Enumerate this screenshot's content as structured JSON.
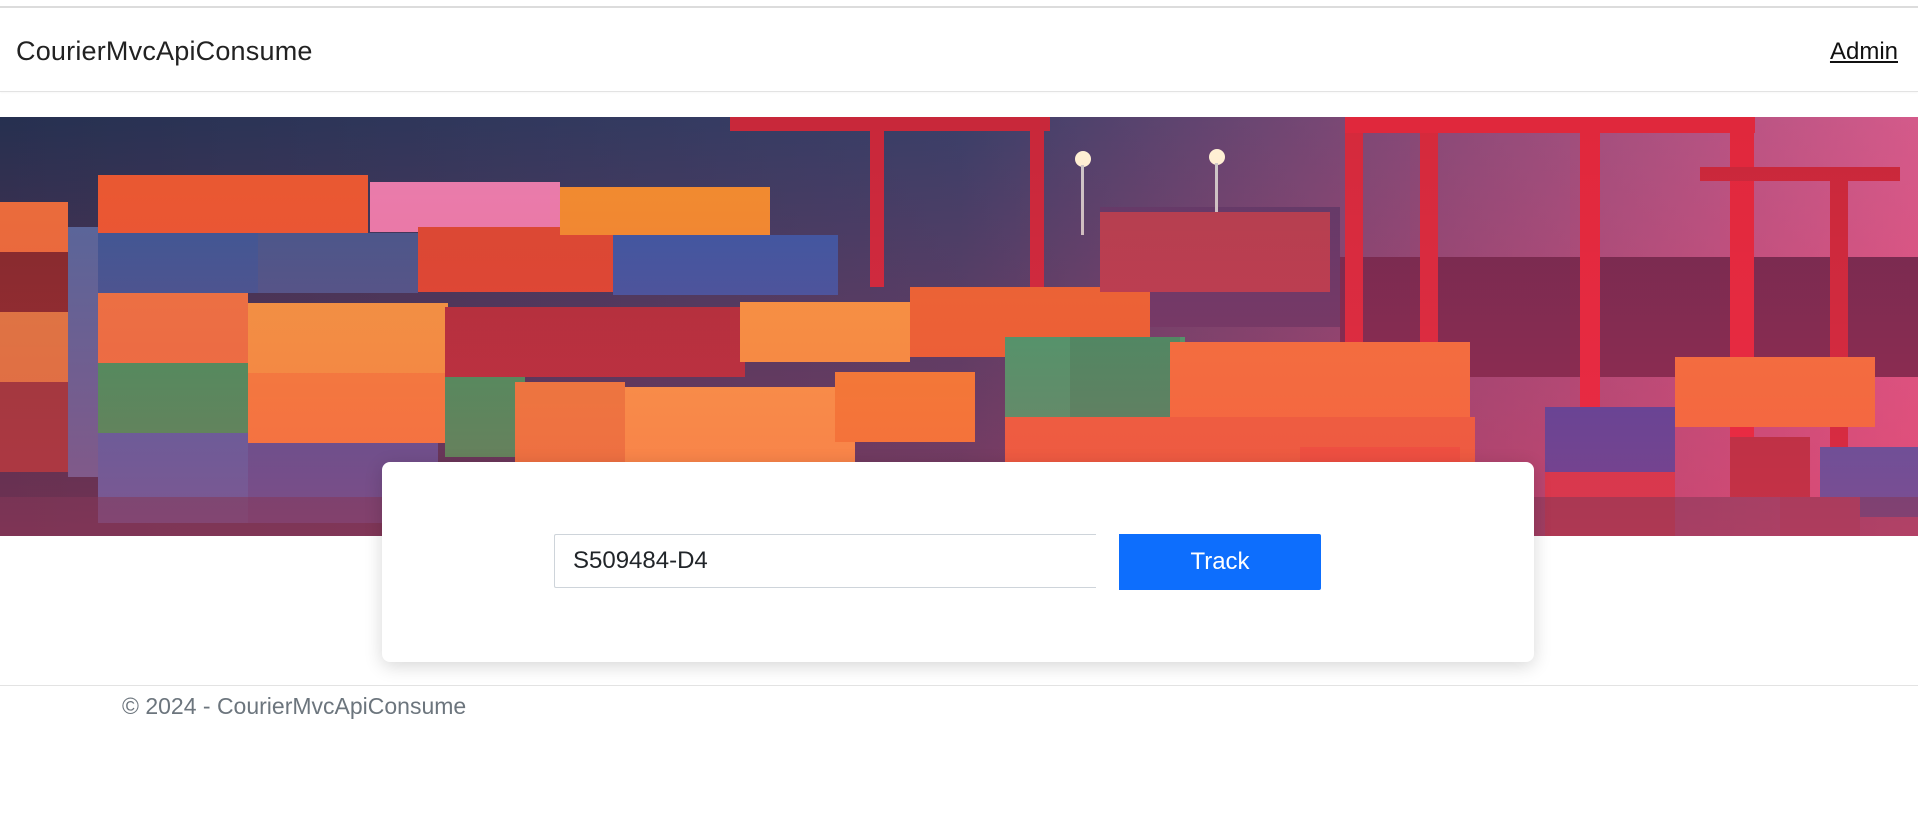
{
  "navbar": {
    "brand": "CourierMvcApiConsume",
    "links": [
      "Admin"
    ]
  },
  "hero": {
    "image": "container-port-banner",
    "colors": {
      "sky": "#2b3352",
      "crane": "#e0283c",
      "accent": "#ff6a3d"
    }
  },
  "tracking": {
    "input_value": "S509484-D4",
    "button_label": "Track",
    "button_color": "#0d6efd"
  },
  "footer": {
    "text": "© 2024 - CourierMvcApiConsume"
  }
}
